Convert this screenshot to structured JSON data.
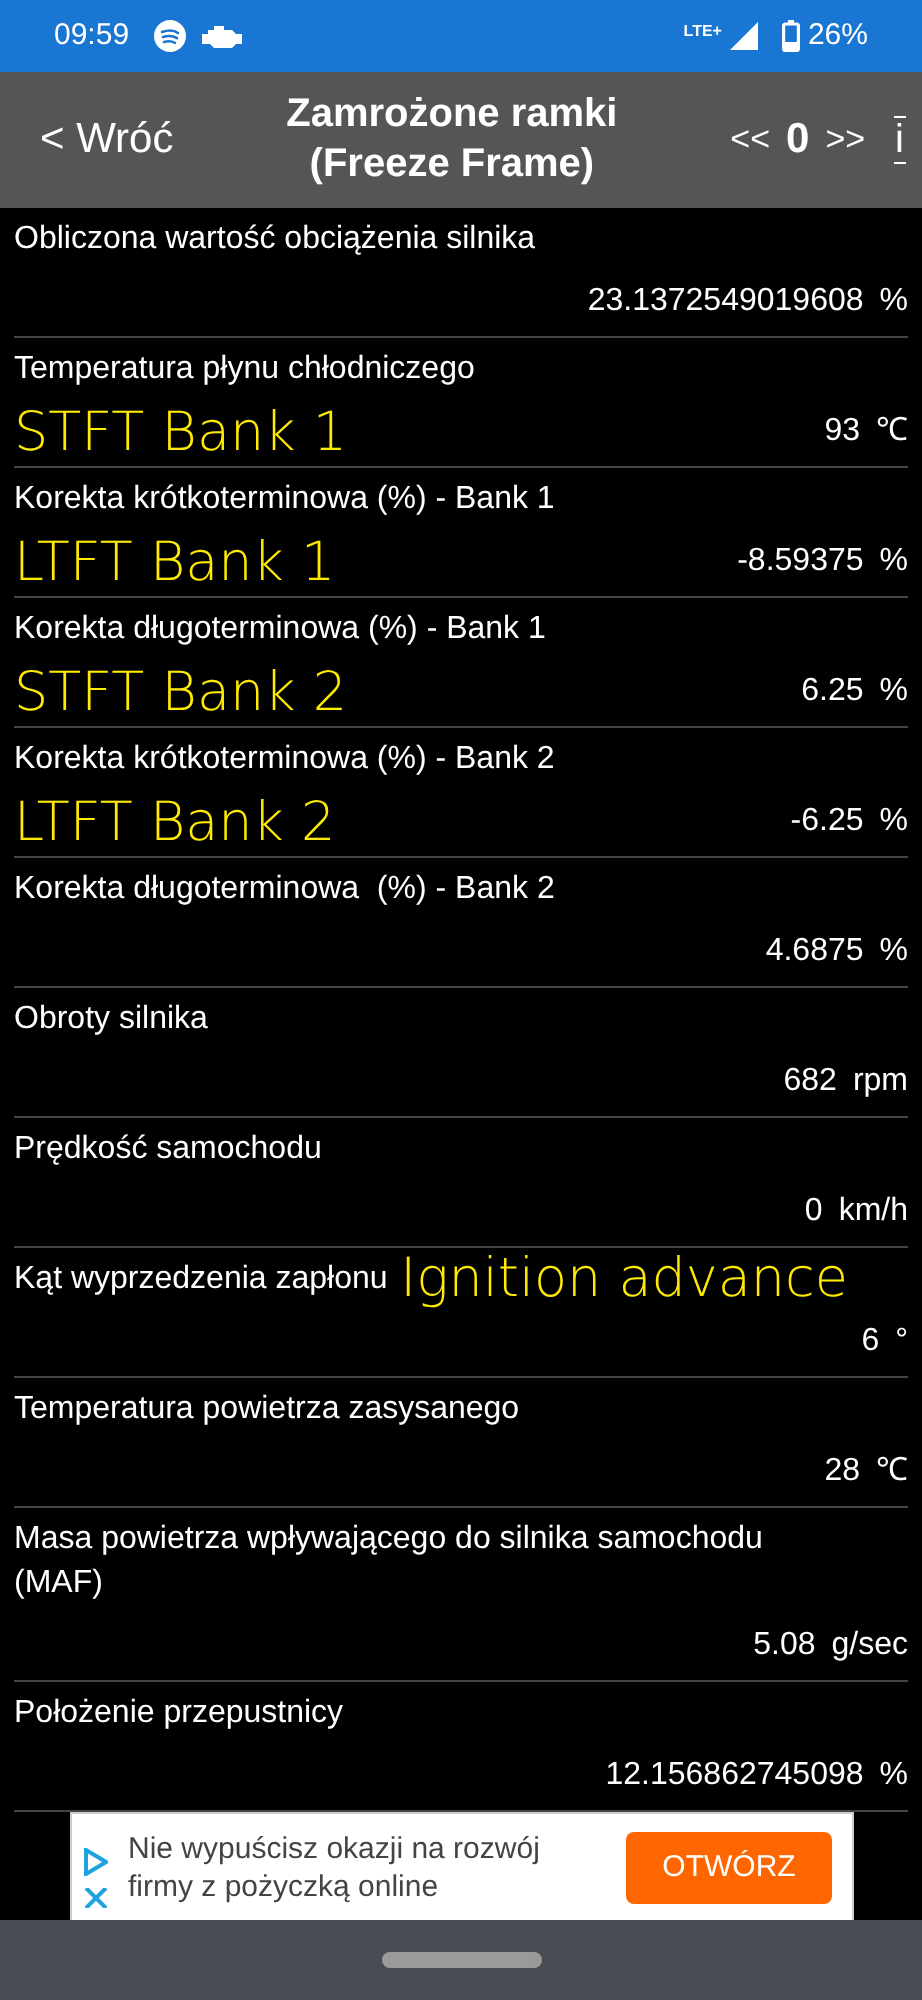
{
  "status_bar": {
    "time": "09:59",
    "network": "LTE+",
    "battery": "26%"
  },
  "header": {
    "back": "< Wróć",
    "title": "Zamrożone ramki",
    "subtitle": "(Freeze Frame)",
    "prev": "<<",
    "frame": "0",
    "next": ">>",
    "info": "i"
  },
  "rows": [
    {
      "label": "Obliczona wartość obciążenia silnika",
      "value": "23.1372549019608",
      "unit": "%"
    },
    {
      "label": "Temperatura płynu chłodniczego",
      "value": "93",
      "unit": "℃",
      "annotation": {
        "text": "STFT Bank 1",
        "kind": "value_line"
      }
    },
    {
      "label": "Korekta krótkoterminowa (%) - Bank 1",
      "value": "-8.59375",
      "unit": "%",
      "annotation": {
        "text": "LTFT Bank 1",
        "kind": "value_line"
      }
    },
    {
      "label": "Korekta długoterminowa (%) - Bank 1",
      "value": "6.25",
      "unit": "%",
      "annotation": {
        "text": "STFT Bank 2",
        "kind": "value_line"
      }
    },
    {
      "label": "Korekta krótkoterminowa (%) - Bank 2",
      "value": "-6.25",
      "unit": "%",
      "annotation": {
        "text": "LTFT Bank 2",
        "kind": "value_line"
      }
    },
    {
      "label": "Korekta długoterminowa  (%) - Bank 2",
      "value": "4.6875",
      "unit": "%"
    },
    {
      "label": "Obroty silnika",
      "value": "682",
      "unit": "rpm"
    },
    {
      "label": "Prędkość samochodu",
      "value": "0",
      "unit": "km/h"
    },
    {
      "label": "Kąt wyprzedzenia zapłonu",
      "value": "6",
      "unit": "°",
      "annotation": {
        "text": "Ignition advance",
        "kind": "label_line"
      }
    },
    {
      "label": "Temperatura powietrza zasysanego",
      "value": "28",
      "unit": "℃"
    },
    {
      "label": "Masa powietrza wpływającego do silnika samochodu (MAF)",
      "value": "5.08",
      "unit": "g/sec"
    },
    {
      "label": "Położenie przepustnicy",
      "value": "12.156862745098",
      "unit": "%"
    }
  ],
  "ad": {
    "text": "Nie wypuścisz okazji na rozwój firmy z pożyczką online",
    "button": "OTWÓRZ"
  }
}
